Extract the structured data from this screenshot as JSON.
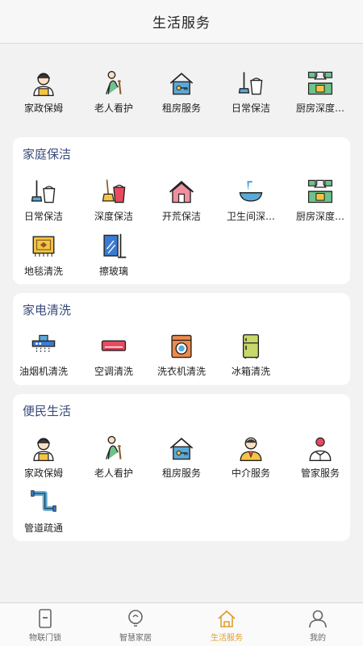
{
  "header": {
    "title": "生活服务"
  },
  "top_services": [
    {
      "label": "家政保姆",
      "icon": "nanny-icon"
    },
    {
      "label": "老人看护",
      "icon": "elderly-care-icon"
    },
    {
      "label": "租房服务",
      "icon": "house-key-icon"
    },
    {
      "label": "日常保洁",
      "icon": "mop-bucket-icon"
    },
    {
      "label": "厨房深度…",
      "icon": "kitchen-icon"
    }
  ],
  "sections": [
    {
      "title": "家庭保洁",
      "items": [
        {
          "label": "日常保洁",
          "icon": "mop-bucket-icon"
        },
        {
          "label": "深度保洁",
          "icon": "broom-bucket-icon"
        },
        {
          "label": "开荒保洁",
          "icon": "house-icon"
        },
        {
          "label": "卫生间深…",
          "icon": "washbasin-icon"
        },
        {
          "label": "厨房深度…",
          "icon": "kitchen-icon"
        },
        {
          "label": "地毯清洗",
          "icon": "carpet-icon"
        },
        {
          "label": "擦玻璃",
          "icon": "window-icon"
        }
      ]
    },
    {
      "title": "家电清洗",
      "items": [
        {
          "label": "油烟机清洗",
          "icon": "range-hood-icon"
        },
        {
          "label": "空调清洗",
          "icon": "air-conditioner-icon"
        },
        {
          "label": "洗衣机清洗",
          "icon": "washing-machine-icon"
        },
        {
          "label": "冰箱清洗",
          "icon": "fridge-icon"
        }
      ]
    },
    {
      "title": "便民生活",
      "items": [
        {
          "label": "家政保姆",
          "icon": "nanny-icon"
        },
        {
          "label": "老人看护",
          "icon": "elderly-care-icon"
        },
        {
          "label": "租房服务",
          "icon": "house-key-icon"
        },
        {
          "label": "中介服务",
          "icon": "agent-icon"
        },
        {
          "label": "管家服务",
          "icon": "butler-icon"
        },
        {
          "label": "管道疏通",
          "icon": "pipe-icon"
        }
      ]
    }
  ],
  "tabbar": [
    {
      "label": "物联门锁",
      "icon": "door-lock-icon",
      "active": false
    },
    {
      "label": "智慧家居",
      "icon": "smart-home-icon",
      "active": false
    },
    {
      "label": "生活服务",
      "icon": "life-service-icon",
      "active": true
    },
    {
      "label": "我的",
      "icon": "profile-icon",
      "active": false
    }
  ],
  "colors": {
    "active_tab": "#e0a030",
    "section_title": "#3a4a7a",
    "background": "#f2f2f2"
  }
}
